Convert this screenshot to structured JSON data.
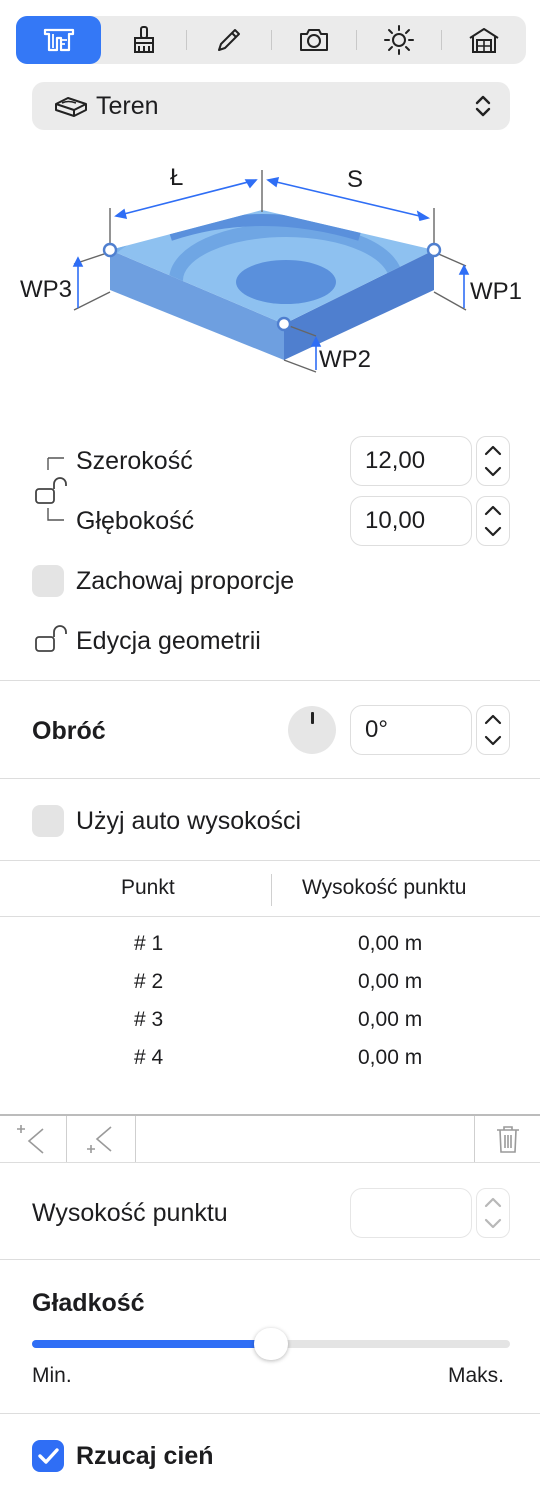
{
  "toolbar": {
    "tabs": [
      {
        "icon": "terrain-tool-icon",
        "active": true
      },
      {
        "icon": "paint-brush-icon",
        "active": false
      },
      {
        "icon": "pencil-icon",
        "active": false
      },
      {
        "icon": "camera-icon",
        "active": false
      },
      {
        "icon": "sun-icon",
        "active": false
      },
      {
        "icon": "house-icon",
        "active": false
      }
    ]
  },
  "dropdown": {
    "label": "Teren",
    "icon": "terrain-icon"
  },
  "diagram": {
    "l": "Ł",
    "s": "S",
    "wp1": "WP1",
    "wp2": "WP2",
    "wp3": "WP3"
  },
  "dimensions": {
    "width_label": "Szerokość",
    "width_value": "12,00",
    "depth_label": "Głębokość",
    "depth_value": "10,00",
    "keep_ratio_label": "Zachowaj proporcje",
    "edit_geometry_label": "Edycja geometrii"
  },
  "rotate": {
    "label": "Obróć",
    "value": "0°"
  },
  "auto_height": {
    "label": "Użyj auto wysokości"
  },
  "table": {
    "headers": [
      "Punkt",
      "Wysokość punktu"
    ],
    "rows": [
      [
        "# 1",
        "0,00 m"
      ],
      [
        "# 2",
        "0,00 m"
      ],
      [
        "# 3",
        "0,00 m"
      ],
      [
        "# 4",
        "0,00 m"
      ]
    ]
  },
  "point_height": {
    "label": "Wysokość punktu",
    "value": ""
  },
  "smoothness": {
    "label": "Gładkość",
    "min": "Min.",
    "max": "Maks.",
    "value": 0.5
  },
  "shadow": {
    "label": "Rzucaj cień",
    "checked": true
  },
  "colors": {
    "accent": "#2f6ef5",
    "terrain": "#8ec1f0"
  }
}
